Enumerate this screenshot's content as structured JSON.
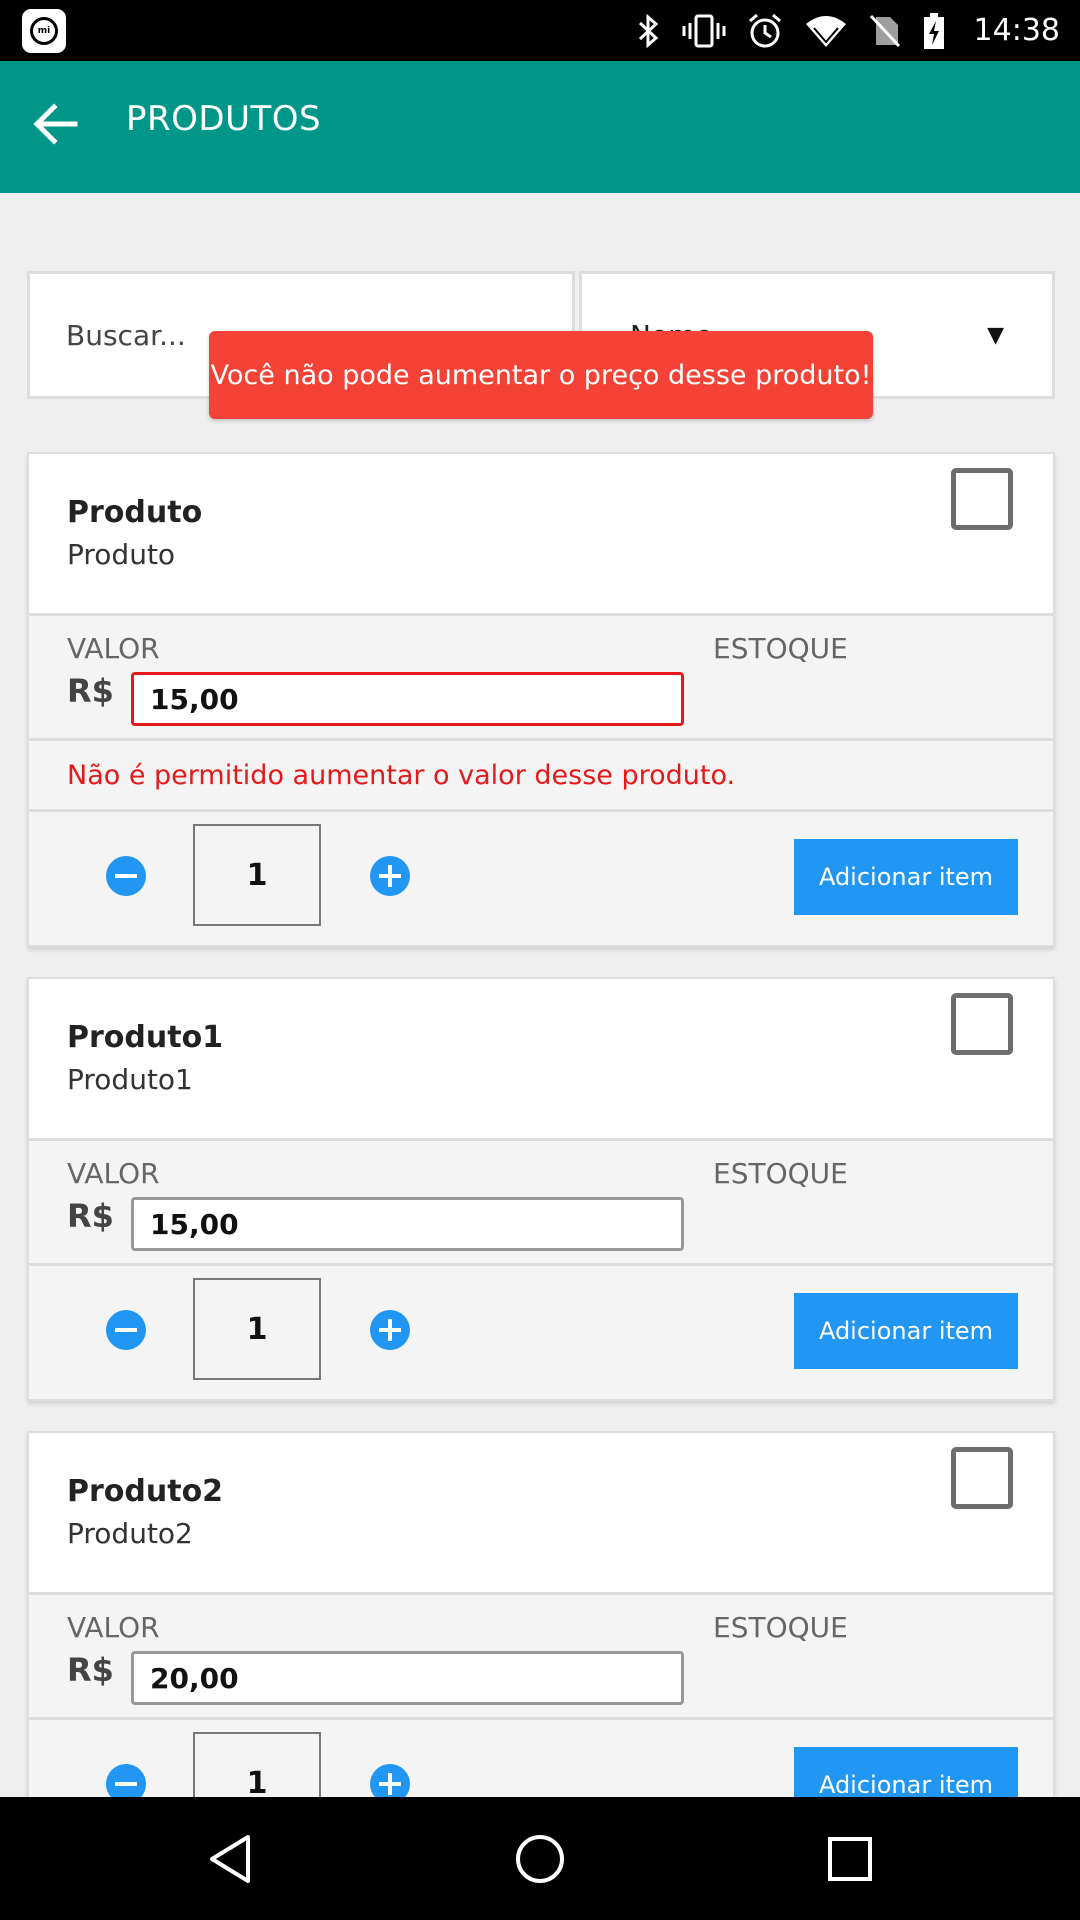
{
  "status_bar": {
    "time": "14:38",
    "icons": [
      "mi-icon",
      "bluetooth-icon",
      "vibrate-icon",
      "alarm-icon",
      "wifi-icon",
      "no-sim-icon",
      "battery-charging-icon"
    ]
  },
  "app_bar": {
    "title": "PRODUTOS",
    "back_icon": "arrow-left-icon"
  },
  "toast": {
    "message": "Você não pode aumentar o preço desse produto!"
  },
  "search": {
    "placeholder": "Buscar...",
    "sort_value": "Nome"
  },
  "products": [
    {
      "name": "Produto",
      "subtitle": "Produto",
      "valor_label": "VALOR",
      "currency": "R$",
      "price": "15,00",
      "estoque_label": "ESTOQUE",
      "error": "Não é permitido aumentar o valor desse produto.",
      "quantity": "1",
      "add_label": "Adicionar item"
    },
    {
      "name": "Produto1",
      "subtitle": "Produto1",
      "valor_label": "VALOR",
      "currency": "R$",
      "price": "15,00",
      "estoque_label": "ESTOQUE",
      "quantity": "1",
      "add_label": "Adicionar item"
    },
    {
      "name": "Produto2",
      "subtitle": "Produto2",
      "valor_label": "VALOR",
      "currency": "R$",
      "price": "20,00",
      "estoque_label": "ESTOQUE",
      "quantity": "1",
      "add_label": "Adicionar item"
    }
  ],
  "colors": {
    "app_bar": "#009688",
    "toast": "#f44336",
    "accent": "#2196f3",
    "error": "#e41a1a"
  }
}
